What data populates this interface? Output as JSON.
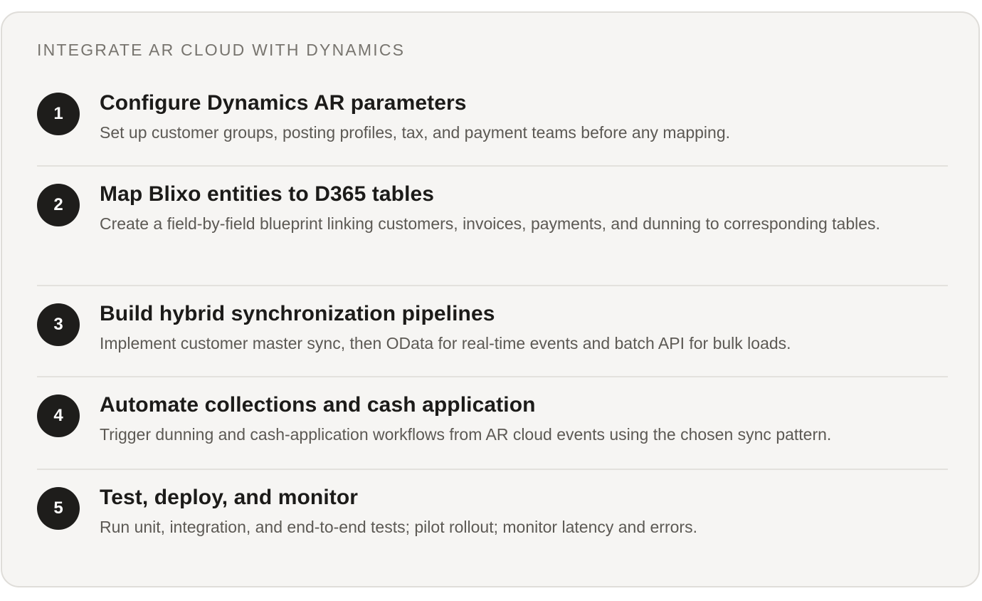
{
  "card": {
    "eyebrow": "INTEGRATE AR CLOUD WITH DYNAMICS"
  },
  "steps": [
    {
      "number": "1",
      "title": "Configure Dynamics AR parameters",
      "description": "Set up customer groups, posting profiles, tax, and payment teams before any mapping."
    },
    {
      "number": "2",
      "title": "Map Blixo entities to D365 tables",
      "description": "Create a field-by-field blueprint linking customers, invoices, payments, and dunning to corresponding tables."
    },
    {
      "number": "3",
      "title": "Build hybrid synchronization pipelines",
      "description": "Implement customer master sync, then OData for real-time events and batch API for bulk loads."
    },
    {
      "number": "4",
      "title": "Automate collections and cash application",
      "description": "Trigger dunning and cash-application workflows from AR cloud events using the chosen sync pattern."
    },
    {
      "number": "5",
      "title": "Test, deploy, and monitor",
      "description": "Run unit, integration, and end-to-end tests; pilot rollout; monitor latency and errors."
    }
  ],
  "colors": {
    "card_background": "#f6f5f3",
    "card_border": "#dfddd9",
    "badge_background": "#1e1d1b",
    "title_text": "#1c1b19",
    "description_text": "#5c5954",
    "eyebrow_text": "#77746e"
  }
}
